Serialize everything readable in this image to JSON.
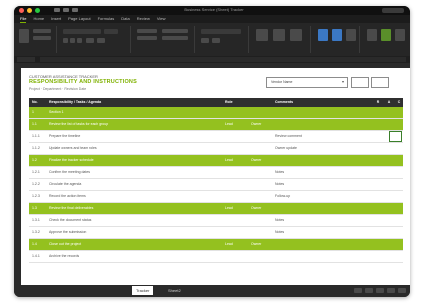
{
  "app": {
    "window_title": "Business Service (Sheet) Tracker",
    "tabs": [
      "File",
      "Home",
      "Insert",
      "Page Layout",
      "Formulas",
      "Data",
      "Review",
      "View"
    ],
    "active_tab": "Home"
  },
  "sheet": {
    "subtitle": "CUSTOMER ASSISTANCE TRACKER",
    "title": "RESPONSIBILITY AND INSTRUCTIONS",
    "meta": "Project · Department · Revision Date",
    "dropdown_value": "Vendor Name",
    "headers": {
      "no": "No.",
      "task": "Responsibility / Tasks / Agenda",
      "role": "Role",
      "req": "Comments",
      "a": "R",
      "b": "A",
      "c": "C"
    },
    "rows": [
      {
        "type": "green",
        "no": "1",
        "task": "Section 1",
        "role": "",
        "tag": "",
        "req": "",
        "a": "",
        "b": "",
        "c": ""
      },
      {
        "type": "green",
        "no": "1.1",
        "task": "Review the list of tasks for each group",
        "role": "Lead",
        "tag": "Owner",
        "req": "",
        "a": "",
        "b": "",
        "c": ""
      },
      {
        "type": "white",
        "no": "1.1.1",
        "task": "Prepare the timeline",
        "role": "",
        "tag": "",
        "req": "Review comment",
        "a": "",
        "b": "",
        "c": ""
      },
      {
        "type": "white",
        "no": "1.1.2",
        "task": "Update owners and team roles",
        "role": "",
        "tag": "",
        "req": "Owner update",
        "a": "",
        "b": "",
        "c": ""
      },
      {
        "type": "green",
        "no": "1.2",
        "task": "Finalize the tracker schedule",
        "role": "Lead",
        "tag": "Owner",
        "req": "",
        "a": "",
        "b": "",
        "c": ""
      },
      {
        "type": "white",
        "no": "1.2.1",
        "task": "Confirm the meeting dates",
        "role": "",
        "tag": "",
        "req": "Notes",
        "a": "",
        "b": "",
        "c": ""
      },
      {
        "type": "white",
        "no": "1.2.2",
        "task": "Circulate the agenda",
        "role": "",
        "tag": "",
        "req": "Notes",
        "a": "",
        "b": "",
        "c": ""
      },
      {
        "type": "white",
        "no": "1.2.3",
        "task": "Record the action items",
        "role": "",
        "tag": "",
        "req": "Follow-up",
        "a": "",
        "b": "",
        "c": ""
      },
      {
        "type": "green",
        "no": "1.3",
        "task": "Review the final deliverables",
        "role": "Lead",
        "tag": "Owner",
        "req": "",
        "a": "",
        "b": "",
        "c": ""
      },
      {
        "type": "white",
        "no": "1.3.1",
        "task": "Check the document status",
        "role": "",
        "tag": "",
        "req": "Notes",
        "a": "",
        "b": "",
        "c": ""
      },
      {
        "type": "white",
        "no": "1.3.2",
        "task": "Approve the submission",
        "role": "",
        "tag": "",
        "req": "Notes",
        "a": "",
        "b": "",
        "c": ""
      },
      {
        "type": "green",
        "no": "1.4",
        "task": "Close out the project",
        "role": "Lead",
        "tag": "Owner",
        "req": "",
        "a": "",
        "b": "",
        "c": ""
      },
      {
        "type": "white",
        "no": "1.4.1",
        "task": "Archive the records",
        "role": "",
        "tag": "",
        "req": "",
        "a": "",
        "b": "",
        "c": ""
      }
    ],
    "sheet_tabs": [
      "Tracker",
      "Sheet2"
    ]
  },
  "colors": {
    "accent": "#94c11f",
    "dark": "#1c1c1c",
    "header": "#2f2f2f"
  }
}
